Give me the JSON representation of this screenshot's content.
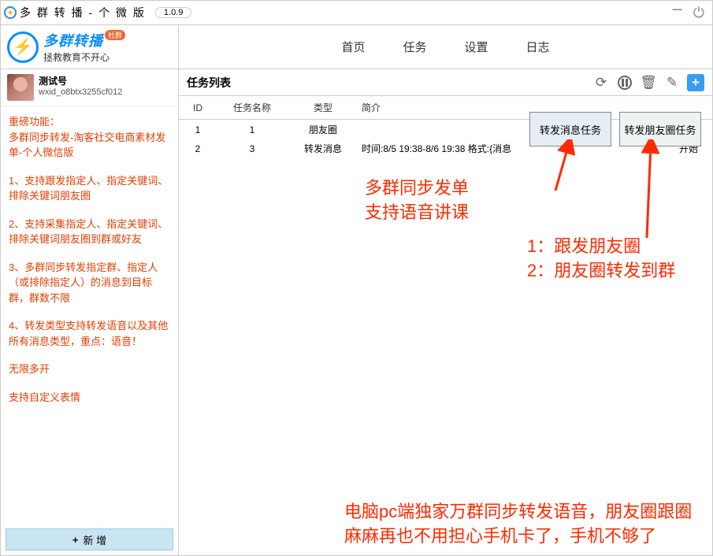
{
  "titlebar": {
    "title": "多 群 转 播 - 个 微 版",
    "version": "1.0.9"
  },
  "brand": {
    "name": "多群转播",
    "badge": "社群",
    "sub": "拯救教育不开心"
  },
  "user": {
    "name": "测试号",
    "id": "wxid_o8btx3255cf012"
  },
  "nav": {
    "home": "首页",
    "task": "任务",
    "setting": "设置",
    "log": "日志"
  },
  "tasklist": {
    "title": "任务列表",
    "headers": {
      "id": "ID",
      "name": "任务名称",
      "type": "类型",
      "intro": "简介",
      "op": ""
    },
    "rows": [
      {
        "id": "1",
        "name": "1",
        "type": "朋友圈",
        "intro": "",
        "op": ""
      },
      {
        "id": "2",
        "name": "3",
        "type": "转发消息",
        "intro": "时间:8/5 19:38-8/6 19:38 格式:{消息",
        "op": "开始"
      }
    ]
  },
  "popup": {
    "btn1": "转发消息任务",
    "btn2": "转发朋友圈任务"
  },
  "features": {
    "l0": "重磅功能：",
    "l1": "多群同步转发-淘客社交电商素材发单-个人微信版",
    "l2": "1、支持跟发指定人、指定关键词、排除关键词朋友圈",
    "l3": "2、支持采集指定人、指定关键词、排除关键词朋友圈到群或好友",
    "l4": "3、多群同步转发指定群、指定人（或排除指定人）的消息到目标群，群数不限",
    "l5": "4、转发类型支持转发语音以及其他所有消息类型，重点：语音！",
    "l6": "无限多开",
    "l7": "支持自定义表情"
  },
  "addbtn": "新 增",
  "annot": {
    "a1": "多群同步发单\n支持语音讲课",
    "a2": "1：跟发朋友圈\n2：朋友圈转发到群",
    "a3": "电脑pc端独家万群同步转发语音，朋友圈跟圈麻麻再也不用担心手机卡了，手机不够了"
  }
}
